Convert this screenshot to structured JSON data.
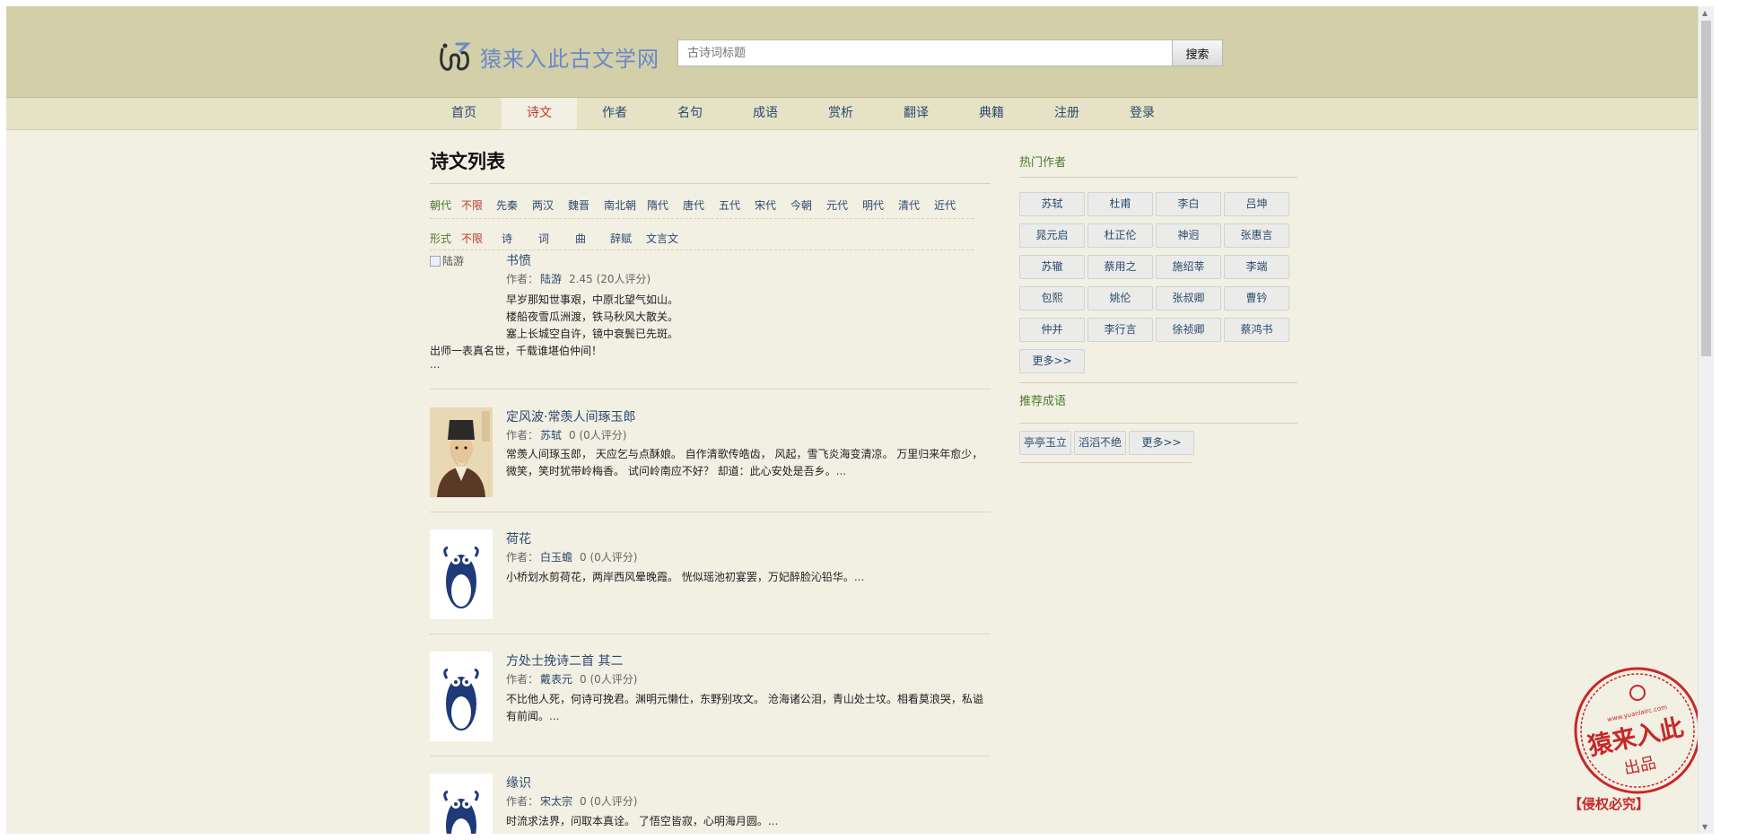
{
  "header": {
    "site_title": "猿来入此古文学网",
    "search_placeholder": "古诗词标题",
    "search_button": "搜索"
  },
  "nav": [
    {
      "label": "首页"
    },
    {
      "label": "诗文",
      "active": true
    },
    {
      "label": "作者"
    },
    {
      "label": "名句"
    },
    {
      "label": "成语"
    },
    {
      "label": "赏析"
    },
    {
      "label": "翻译"
    },
    {
      "label": "典籍"
    },
    {
      "label": "注册"
    },
    {
      "label": "登录"
    }
  ],
  "main": {
    "title": "诗文列表",
    "dynasty_filter": {
      "label": "朝代",
      "selected": "不限",
      "options": [
        "先秦",
        "两汉",
        "魏晋",
        "南北朝",
        "隋代",
        "唐代",
        "五代",
        "宋代",
        "今朝",
        "元代",
        "明代",
        "清代",
        "近代"
      ]
    },
    "form_filter": {
      "label": "形式",
      "selected": "不限",
      "options": [
        "诗",
        "词",
        "曲",
        "辞赋",
        "文言文"
      ]
    },
    "author_prefix": "作者：",
    "poems": [
      {
        "title": "书愤",
        "author": "陆游",
        "rating": "2.45 (20人评分)",
        "image_alt": "陆游",
        "lines": [
          "早岁那知世事艰，中原北望气如山。",
          "楼船夜雪瓜洲渡，铁马秋风大散关。",
          "塞上长城空自许，镜中衰鬓已先斑。",
          "出师一表真名世，千载谁堪伯仲间！"
        ],
        "more": "..."
      },
      {
        "title": "定风波·常羡人间琢玉郎",
        "author": "苏轼",
        "rating": "0 (0人评分)",
        "text": "常羡人间琢玉郎， 天应乞与点酥娘。 自作清歌传皓齿， 风起，雪飞炎海变清凉。 万里归来年愈少， 微笑，笑时犹带岭梅香。 试问岭南应不好？ 却道：此心安处是吾乡。",
        "more": "..."
      },
      {
        "title": "荷花",
        "author": "白玉蟾",
        "rating": "0 (0人评分)",
        "text": "小桥划水剪荷花，两岸西风晕晚霞。 恍似瑶池初宴罢，万妃醉脸沁铅华。",
        "more": "..."
      },
      {
        "title": "方处士挽诗二首 其二",
        "author": "戴表元",
        "rating": "0 (0人评分)",
        "text": "不比他人死，何诗可挽君。渊明元懒仕，东野别攻文。 沧海诸公泪，青山处士坟。相看莫浪哭，私谥有前闻。",
        "more": "..."
      },
      {
        "title": "缘识",
        "author": "宋太宗",
        "rating": "0 (0人评分)",
        "text": "时流求法界，问取本真诠。 了悟空皆寂，心明海月圆。",
        "more": "..."
      }
    ]
  },
  "sidebar": {
    "hot_authors_title": "热门作者",
    "hot_authors": [
      "苏轼",
      "杜甫",
      "李白",
      "吕坤",
      "晁元启",
      "杜正伦",
      "神迥",
      "张惠言",
      "苏辙",
      "蔡用之",
      "施绍莘",
      "李端",
      "包熙",
      "姚伦",
      "张叔卿",
      "曹钤",
      "仲并",
      "李行言",
      "徐祯卿",
      "蔡鸿书"
    ],
    "hot_authors_more": "更多>>",
    "idioms_title": "推荐成语",
    "idioms": [
      "亭亭玉立",
      "滔滔不绝"
    ],
    "idioms_more": "更多>>"
  },
  "stamp": {
    "main_text": "猿来入此",
    "sub_text": "出品",
    "url_text": "www.yuanlairc.com",
    "caption": "【侵权必究】"
  },
  "colors": {
    "header_bg": "#d2cfa9",
    "nav_bg": "#e5e2c6",
    "page_bg": "#f2efe3",
    "link": "#2c4a6e",
    "active": "#c0392b",
    "label_green": "#4a7a2c",
    "stamp_red": "#c62828"
  }
}
